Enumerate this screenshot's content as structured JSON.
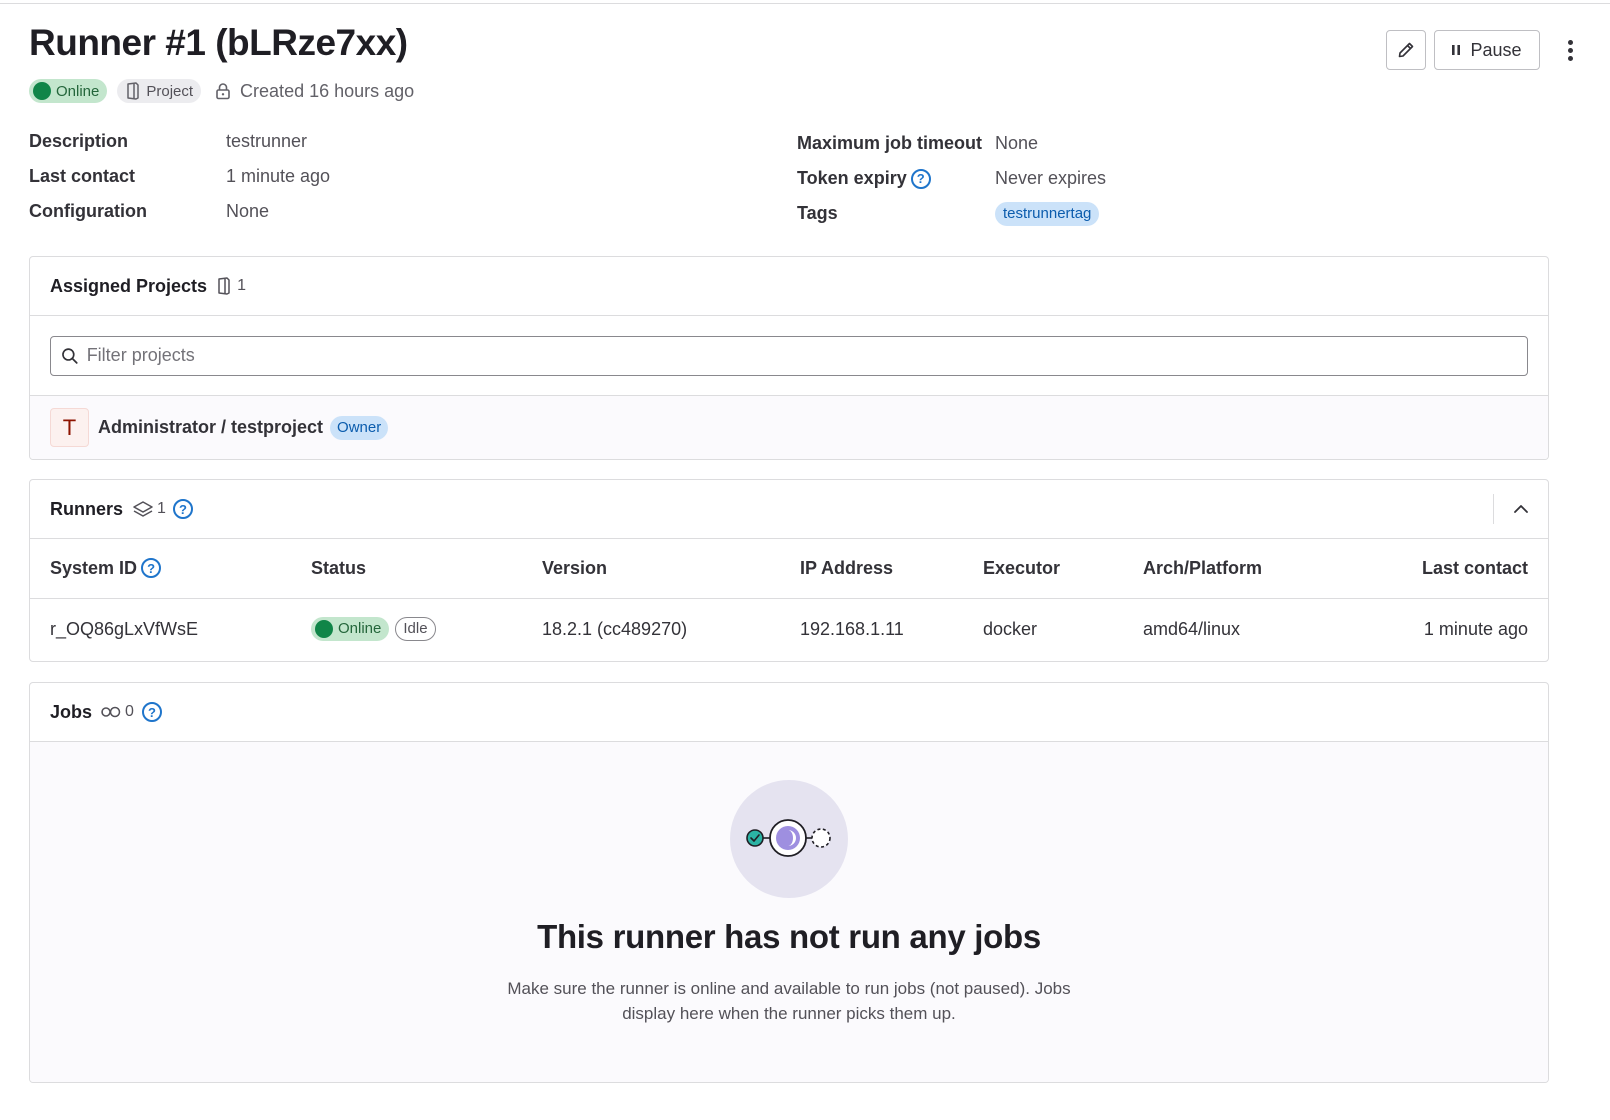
{
  "header": {
    "title": "Runner #1 (bLRze7xx)",
    "status": "Online",
    "type": "Project",
    "created": "Created 16 hours ago",
    "pause_label": "Pause"
  },
  "details": {
    "left": [
      {
        "label": "Description",
        "value": "testrunner"
      },
      {
        "label": "Last contact",
        "value": "1 minute ago"
      },
      {
        "label": "Configuration",
        "value": "None"
      }
    ],
    "right": [
      {
        "label": "Maximum job timeout",
        "value": "None"
      },
      {
        "label": "Token expiry",
        "value": "Never expires"
      },
      {
        "label": "Tags",
        "value": "testrunnertag"
      }
    ]
  },
  "projects": {
    "title": "Assigned Projects",
    "count": "1",
    "filter_placeholder": "Filter projects",
    "items": [
      {
        "avatar": "T",
        "name": "Administrator / testproject",
        "role": "Owner"
      }
    ]
  },
  "runners": {
    "title": "Runners",
    "count": "1",
    "columns": [
      "System ID",
      "Status",
      "Version",
      "IP Address",
      "Executor",
      "Arch/Platform",
      "Last contact"
    ],
    "rows": [
      {
        "system_id": "r_OQ86gLxVfWsE",
        "status": "Online",
        "state": "Idle",
        "version": "18.2.1 (cc489270)",
        "ip": "192.168.1.11",
        "executor": "docker",
        "arch": "amd64/linux",
        "last_contact": "1 minute ago"
      }
    ]
  },
  "jobs": {
    "title": "Jobs",
    "count": "0",
    "empty_title": "This runner has not run any jobs",
    "empty_desc": "Make sure the runner is online and available to run jobs (not paused). Jobs display here when the runner picks them up."
  },
  "colors": {
    "online_green": "#108548",
    "link_blue": "#1f75cb",
    "tag_bg": "#cbe2f9",
    "illustration_bg": "#e5e3f0"
  }
}
